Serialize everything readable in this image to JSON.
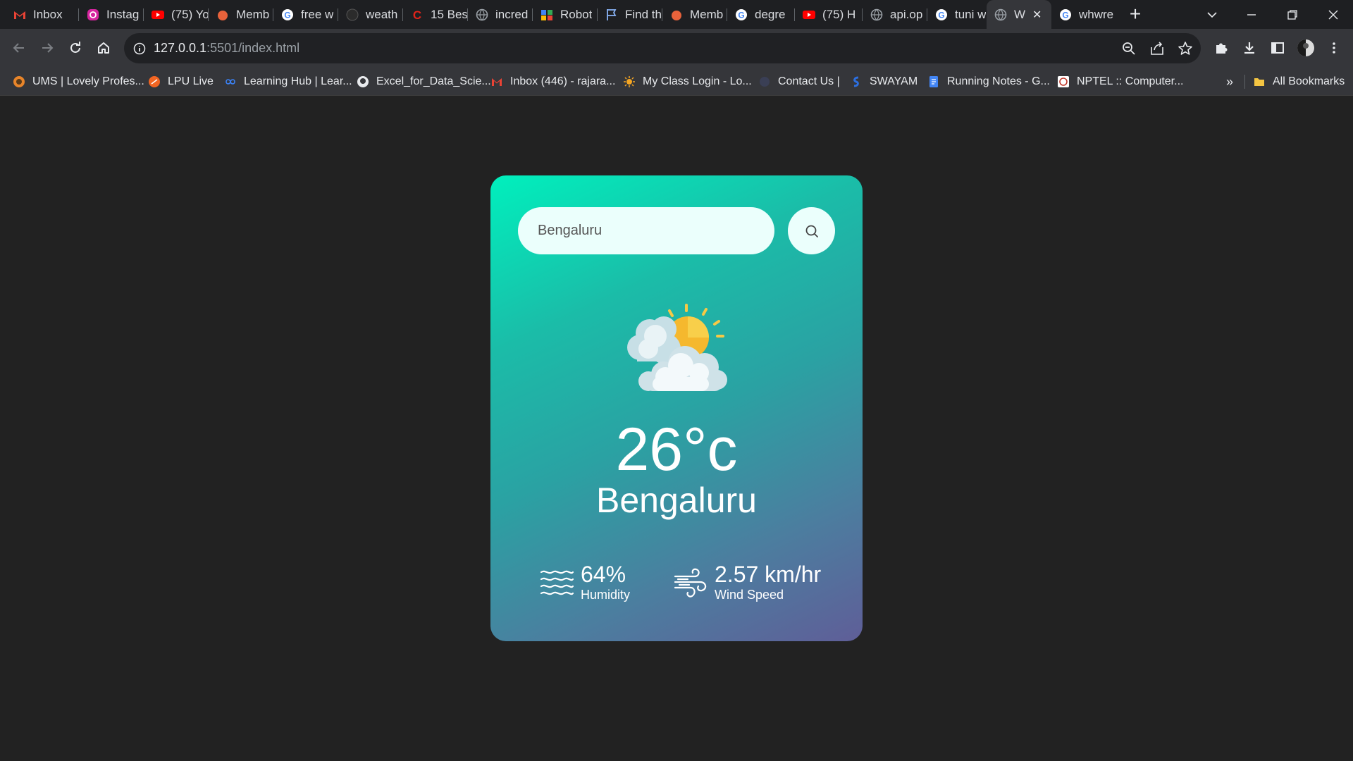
{
  "browser": {
    "tabs": [
      {
        "title": "Inbox",
        "icon": "gmail-icon"
      },
      {
        "title": "Instag",
        "icon": "instagram-icon"
      },
      {
        "title": "(75) Yo",
        "icon": "youtube-icon"
      },
      {
        "title": "Memb",
        "icon": "member-icon"
      },
      {
        "title": "free w",
        "icon": "google-icon"
      },
      {
        "title": "weath",
        "icon": "github-icon"
      },
      {
        "title": "15 Bes",
        "icon": "c-logo-icon"
      },
      {
        "title": "incred",
        "icon": "globe-icon"
      },
      {
        "title": "Robot",
        "icon": "robot-icon"
      },
      {
        "title": "Find th",
        "icon": "flag-icon"
      },
      {
        "title": "Memb",
        "icon": "member-icon"
      },
      {
        "title": "degre",
        "icon": "google-icon"
      },
      {
        "title": "(75) H",
        "icon": "youtube-icon"
      },
      {
        "title": "api.op",
        "icon": "globe-icon"
      },
      {
        "title": "tuni w",
        "icon": "google-icon"
      },
      {
        "title": "W",
        "icon": "globe-icon",
        "active": true
      },
      {
        "title": "whwre",
        "icon": "google-icon"
      }
    ],
    "address_bar": {
      "host": "127.0.0.1",
      "path": ":5501/index.html"
    },
    "bookmarks": [
      {
        "label": "UMS | Lovely Profes...",
        "icon": "ums-icon"
      },
      {
        "label": "LPU Live",
        "icon": "lpu-live-icon"
      },
      {
        "label": "Learning Hub | Lear...",
        "icon": "infinity-icon"
      },
      {
        "label": "Excel_for_Data_Scie...",
        "icon": "github-icon"
      },
      {
        "label": "Inbox (446) - rajara...",
        "icon": "gmail-icon"
      },
      {
        "label": "My Class Login - Lo...",
        "icon": "sun-icon"
      },
      {
        "label": "Contact Us |",
        "icon": "blank-icon"
      },
      {
        "label": "SWAYAM",
        "icon": "swayam-icon"
      },
      {
        "label": "Running Notes - G...",
        "icon": "docs-icon"
      },
      {
        "label": "NPTEL :: Computer...",
        "icon": "nptel-icon"
      }
    ],
    "bookmarks_overflow": "»",
    "all_bookmarks": "All Bookmarks"
  },
  "weather": {
    "search": {
      "value": "Bengaluru",
      "icon": "search-icon"
    },
    "condition_icon": "partly-cloudy-icon",
    "temperature": "26°c",
    "city": "Bengaluru",
    "humidity": {
      "value": "64%",
      "label": "Humidity",
      "icon": "humidity-icon"
    },
    "wind": {
      "value": "2.57 km/hr",
      "label": "Wind Speed",
      "icon": "wind-icon"
    }
  },
  "colors": {
    "page_bg": "#222222",
    "card_gradient_start": "#00f0bd",
    "card_gradient_end": "#5f5e98",
    "input_bg": "#ebfffc"
  }
}
